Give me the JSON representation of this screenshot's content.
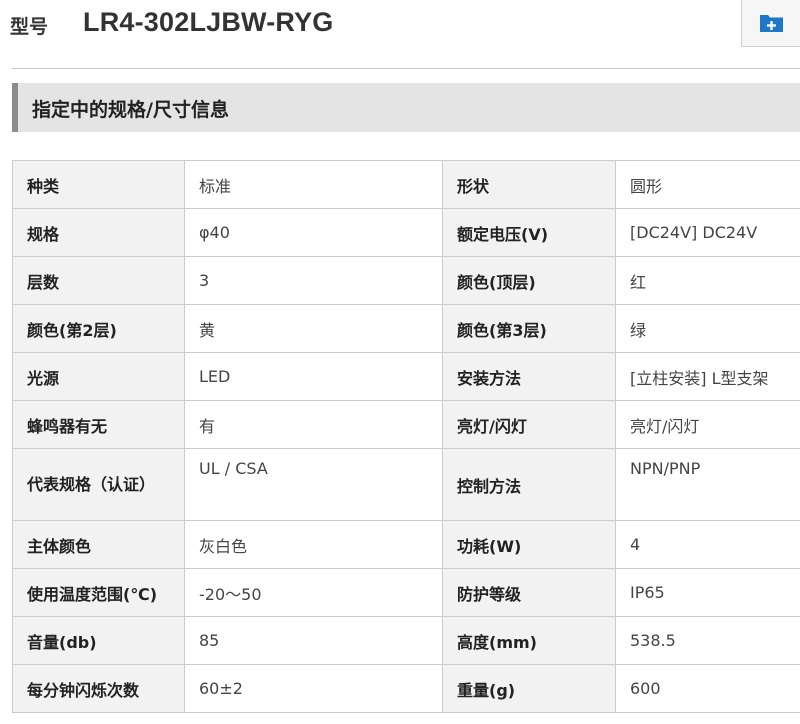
{
  "header": {
    "model_label": "型号",
    "model_name": "LR4-302LJBW-RYG",
    "add_folder_icon": "folder-plus-icon"
  },
  "section": {
    "title": "指定中的规格/尺寸信息"
  },
  "specs": [
    [
      "种类",
      "标准",
      "形状",
      "圆形"
    ],
    [
      "规格",
      "φ40",
      "额定电压(V)",
      "[DC24V] DC24V"
    ],
    [
      "层数",
      "3",
      "颜色(顶层)",
      "红"
    ],
    [
      "颜色(第2层)",
      "黄",
      "颜色(第3层)",
      "绿"
    ],
    [
      "光源",
      "LED",
      "安装方法",
      "[立柱安装] L型支架"
    ],
    [
      "蜂鸣器有无",
      "有",
      "亮灯/闪灯",
      "亮灯/闪灯"
    ],
    [
      "代表规格（认证）",
      "UL / CSA",
      "控制方法",
      "NPN/PNP"
    ],
    [
      "主体颜色",
      "灰白色",
      "功耗(W)",
      "4"
    ],
    [
      "使用温度范围(℃)",
      "-20～50",
      "防护等级",
      "IP65"
    ],
    [
      "音量(db)",
      "85",
      "高度(mm)",
      "538.5"
    ],
    [
      "每分钟闪烁次数",
      "60±2",
      "重量(g)",
      "600"
    ]
  ],
  "colors": {
    "label_bg": "#f2f2f2",
    "section_bg": "#e4e4e4",
    "section_accent": "#8c8c8c",
    "icon_blue": "#1e78c8",
    "border": "#cccccc"
  }
}
